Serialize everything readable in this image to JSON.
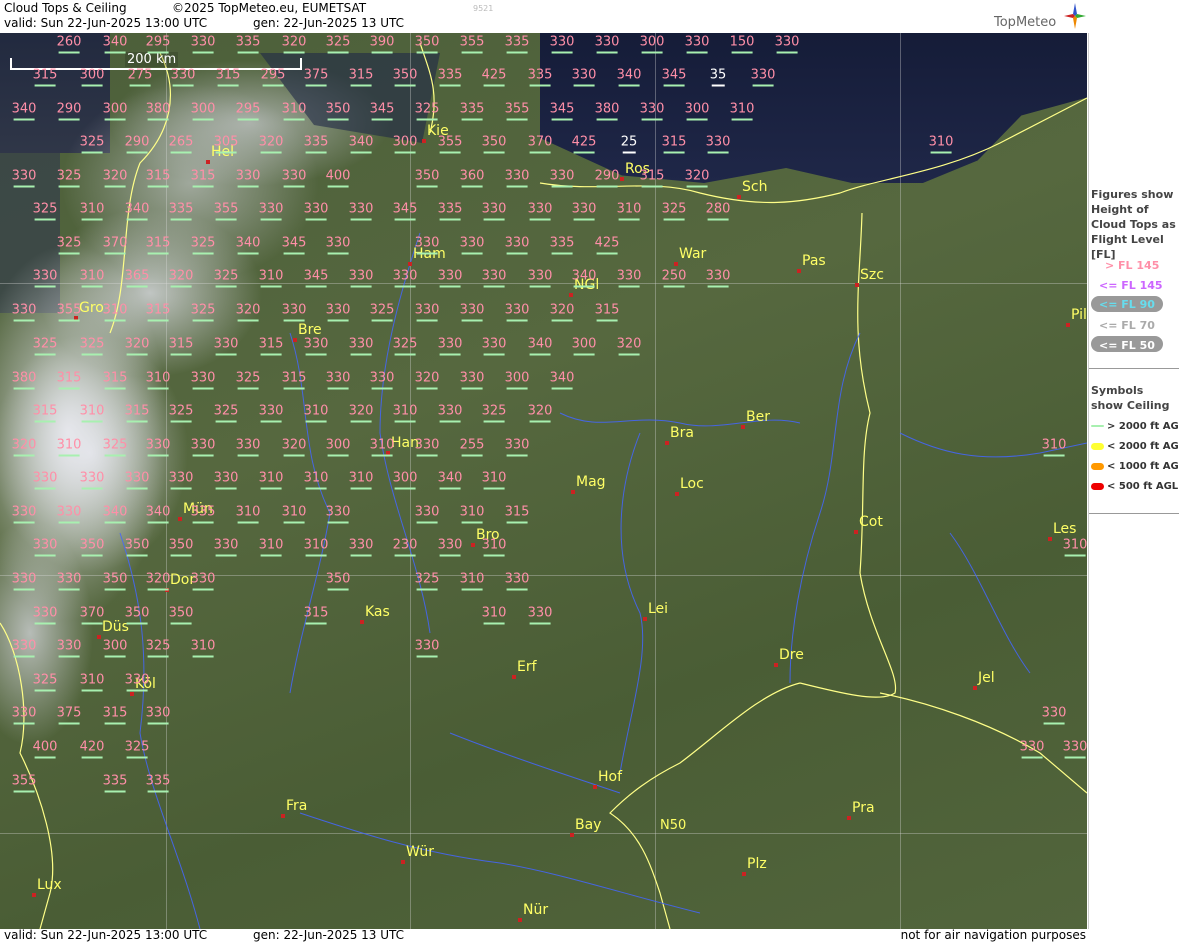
{
  "header": {
    "title": "Cloud Tops & Ceiling",
    "copyright": "©2025 TopMeteo.eu, EUMETSAT",
    "valid": "valid:  Sun  22-Jun-2025  13:00 UTC",
    "gen": "gen:  22-Jun-2025 13 UTC",
    "code": "9521",
    "brand": "TopMeteo"
  },
  "footer": {
    "valid": "valid:  Sun  22-Jun-2025  13:00 UTC",
    "gen": "gen:  22-Jun-2025 13 UTC",
    "disclaimer": "not for air navigation purposes"
  },
  "map": {
    "scale_label": "200 km",
    "grid_label": "N50",
    "cities": [
      {
        "id": "kie",
        "label": "Kie"
      },
      {
        "id": "hel",
        "label": "Hel"
      },
      {
        "id": "ros",
        "label": "Ros"
      },
      {
        "id": "sch",
        "label": "Sch"
      },
      {
        "id": "war",
        "label": "War"
      },
      {
        "id": "pas",
        "label": "Pas"
      },
      {
        "id": "szc",
        "label": "Szc"
      },
      {
        "id": "ham",
        "label": "Ham"
      },
      {
        "id": "ngl",
        "label": "NGl"
      },
      {
        "id": "gro",
        "label": "Gro"
      },
      {
        "id": "bre",
        "label": "Bre"
      },
      {
        "id": "pil",
        "label": "Pil"
      },
      {
        "id": "bra",
        "label": "Bra"
      },
      {
        "id": "ber",
        "label": "Ber"
      },
      {
        "id": "han",
        "label": "Han"
      },
      {
        "id": "mag",
        "label": "Mag"
      },
      {
        "id": "loc",
        "label": "Loc"
      },
      {
        "id": "mun",
        "label": "Mün"
      },
      {
        "id": "cot",
        "label": "Cot"
      },
      {
        "id": "les",
        "label": "Les"
      },
      {
        "id": "bro",
        "label": "Bro"
      },
      {
        "id": "dor",
        "label": "Dor"
      },
      {
        "id": "kas",
        "label": "Kas"
      },
      {
        "id": "lei",
        "label": "Lei"
      },
      {
        "id": "dus",
        "label": "Düs"
      },
      {
        "id": "erf",
        "label": "Erf"
      },
      {
        "id": "dre",
        "label": "Dre"
      },
      {
        "id": "kol",
        "label": "Köl"
      },
      {
        "id": "jel",
        "label": "Jel"
      },
      {
        "id": "hof",
        "label": "Hof"
      },
      {
        "id": "fra",
        "label": "Fra"
      },
      {
        "id": "bay",
        "label": "Bay"
      },
      {
        "id": "pra",
        "label": "Pra"
      },
      {
        "id": "wur",
        "label": "Wür"
      },
      {
        "id": "plz",
        "label": "Plz"
      },
      {
        "id": "lux",
        "label": "Lux"
      },
      {
        "id": "nur",
        "label": "Nür"
      }
    ],
    "flight_levels": [
      "260",
      "340",
      "295",
      "330",
      "335",
      "320",
      "325",
      "390",
      "350",
      "355",
      "335",
      "330",
      "330",
      "300",
      "330",
      "150",
      "330",
      "315",
      "300",
      "275",
      "330",
      "315",
      "295",
      "375",
      "315",
      "350",
      "335",
      "425",
      "335",
      "330",
      "340",
      "345",
      "35",
      "330",
      "340",
      "290",
      "300",
      "380",
      "300",
      "295",
      "310",
      "350",
      "345",
      "325",
      "335",
      "355",
      "345",
      "380",
      "330",
      "300",
      "310",
      "325",
      "290",
      "265",
      "305",
      "320",
      "335",
      "340",
      "300",
      "355",
      "350",
      "370",
      "425",
      "25",
      "315",
      "330",
      "310",
      "330",
      "325",
      "320",
      "315",
      "315",
      "330",
      "330",
      "400",
      "350",
      "360",
      "330",
      "330",
      "290",
      "315",
      "320",
      "325",
      "310",
      "340",
      "335",
      "355",
      "330",
      "330",
      "330",
      "345",
      "335",
      "330",
      "330",
      "330",
      "310",
      "325",
      "280",
      "325",
      "370",
      "315",
      "325",
      "340",
      "345",
      "330",
      "330",
      "330",
      "330",
      "335",
      "425",
      "330",
      "310",
      "365",
      "320",
      "325",
      "310",
      "345",
      "330",
      "330",
      "330",
      "330",
      "330",
      "340",
      "330",
      "250",
      "330",
      "330",
      "355",
      "310",
      "315",
      "325",
      "320",
      "330",
      "330",
      "325",
      "330",
      "330",
      "330",
      "320",
      "315",
      "325",
      "325",
      "320",
      "315",
      "330",
      "315",
      "330",
      "330",
      "325",
      "330",
      "330",
      "340",
      "300",
      "320",
      "380",
      "315",
      "315",
      "310",
      "330",
      "325",
      "315",
      "330",
      "330",
      "320",
      "330",
      "300",
      "340",
      "315",
      "310",
      "315",
      "325",
      "325",
      "330",
      "310",
      "320",
      "310",
      "330",
      "325",
      "320",
      "320",
      "310",
      "325",
      "330",
      "330",
      "330",
      "320",
      "300",
      "310",
      "330",
      "255",
      "330",
      "310",
      "330",
      "330",
      "330",
      "330",
      "330",
      "310",
      "310",
      "310",
      "300",
      "340",
      "310",
      "330",
      "330",
      "340",
      "340",
      "335",
      "310",
      "310",
      "330",
      "330",
      "310",
      "315",
      "330",
      "350",
      "350",
      "350",
      "330",
      "310",
      "310",
      "330",
      "230",
      "330",
      "310",
      "310",
      "330",
      "330",
      "350",
      "320",
      "330",
      "350",
      "325",
      "310",
      "330",
      "330",
      "370",
      "350",
      "350",
      "315",
      "310",
      "330",
      "330",
      "330",
      "300",
      "325",
      "310",
      "330",
      "325",
      "310",
      "330",
      "330",
      "375",
      "315",
      "330",
      "330",
      "400",
      "420",
      "325",
      "330",
      "330",
      "355",
      "335",
      "335"
    ]
  },
  "legend": {
    "title": "Figures show Height of Cloud Tops as Flight Level  [FL]",
    "items": [
      {
        "label": "> FL 145",
        "color": "#ff8fa8"
      },
      {
        "label": "<= FL 145",
        "color": "#cc66ff"
      },
      {
        "label": "<= FL 90",
        "color": "#66ddee"
      },
      {
        "label": "<= FL 70",
        "color": "#aaaaaa"
      },
      {
        "label": "<= FL 50",
        "color": "#ffffff"
      }
    ],
    "ceiling_title": "Symbols show Ceiling",
    "ceiling_items": [
      {
        "label": "> 2000 ft AGL",
        "color": "#a8f0b0"
      },
      {
        "label": "< 2000 ft AGL",
        "color": "#ffff33"
      },
      {
        "label": "< 1000 ft AGL",
        "color": "#ff9900"
      },
      {
        "label": "< 500 ft AGL",
        "color": "#ee0000"
      }
    ]
  }
}
